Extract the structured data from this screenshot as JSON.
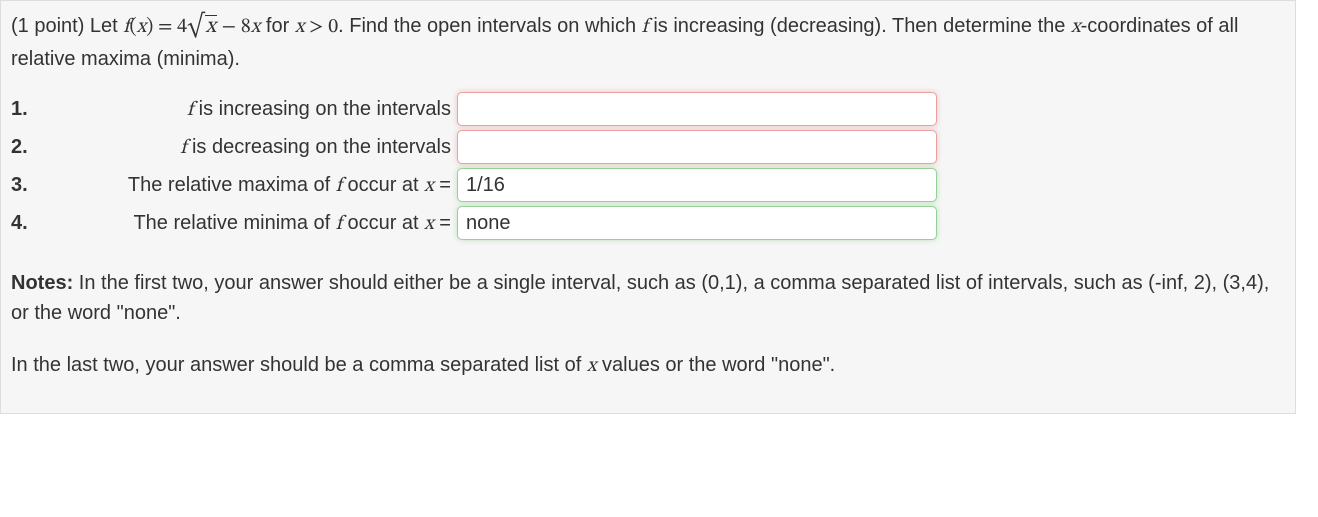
{
  "question": {
    "points_prefix": "(1 point) Let ",
    "func_name": "f",
    "func_arg": "x",
    "equals": " = ",
    "coef1": "4",
    "sqrt_of": "x",
    "minus": " − ",
    "coef2": "8",
    "term2": "x",
    "for": " for ",
    "cond_var": "x",
    "cond_op": " > ",
    "cond_val": "0",
    "after": ". Find the open intervals on which ",
    "f1": "f",
    "after2": " is increasing (decreasing). Then determine the ",
    "xcoord": "x",
    "after3": "-coordinates of all relative maxima (minima)."
  },
  "items": [
    {
      "num": "1.",
      "pre": "",
      "f": "f",
      "post": " is increasing on the intervals",
      "value": "",
      "status": "red"
    },
    {
      "num": "2.",
      "pre": "",
      "f": "f",
      "post": " is decreasing on the intervals",
      "value": "",
      "status": "red"
    },
    {
      "num": "3.",
      "pre": "The relative maxima of ",
      "f": "f",
      "post": " occur at ",
      "var": "x",
      "eq": " =",
      "value": "1/16",
      "status": "green"
    },
    {
      "num": "4.",
      "pre": "The relative minima of ",
      "f": "f",
      "post": " occur at ",
      "var": "x",
      "eq": " =",
      "value": "none",
      "status": "green"
    }
  ],
  "notes": {
    "label": "Notes:",
    "p1a": " In the first two, your answer should either be a single interval, such as (0,1), a comma separated list of intervals, such as (-inf, 2), (3,4), or the word \"none\".",
    "p2a": "In the last two, your answer should be a comma separated list of ",
    "var": "x",
    "p2b": " values or the word \"none\"."
  }
}
